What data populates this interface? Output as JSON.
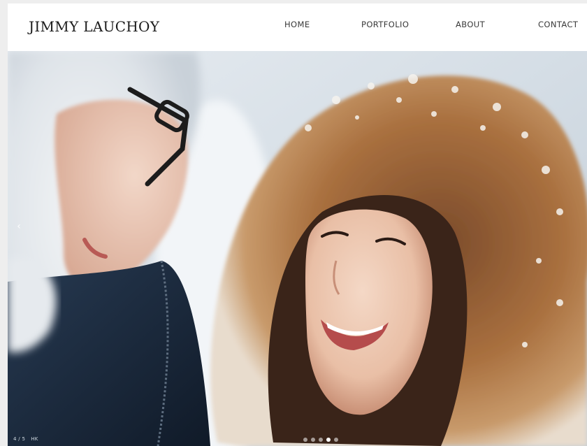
{
  "header": {
    "brand": "JIMMY LAUCHOY",
    "nav": [
      {
        "label": "HOME"
      },
      {
        "label": "PORTFOLIO"
      },
      {
        "label": "ABOUT"
      },
      {
        "label": "CONTACT"
      }
    ]
  },
  "slider": {
    "prev_arrow": "‹",
    "counter": "4 / 5",
    "location": "HK",
    "current_slide": 4,
    "total_slides": 5,
    "image_subject": "couple-in-snow-photo"
  },
  "colors": {
    "background": "#ffffff",
    "page_border": "#eeeeee",
    "text_dark": "#1b1b1b",
    "nav_text": "#3a3a3a",
    "dot_inactive": "#ffffff8c",
    "dot_active": "#ffffff"
  }
}
